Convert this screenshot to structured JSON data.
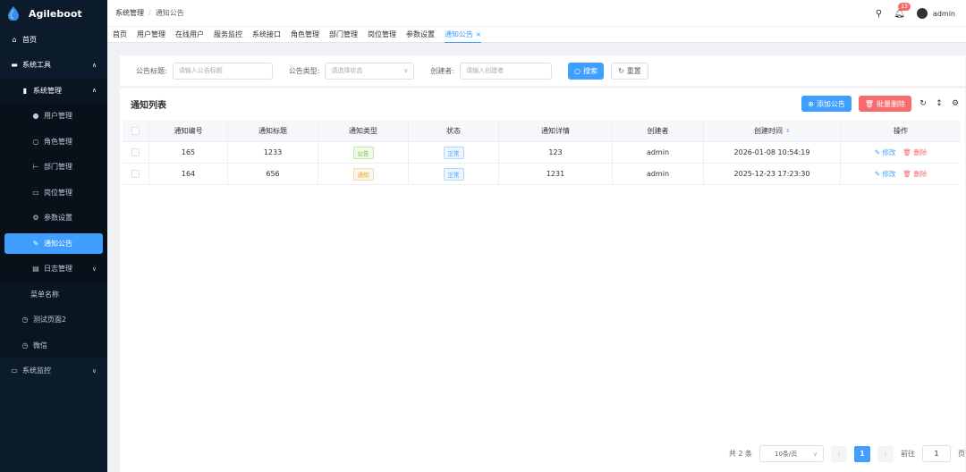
{
  "app": {
    "title": "Agileboot"
  },
  "sidebar": {
    "items": [
      {
        "label": "首页",
        "icon": "home-icon"
      },
      {
        "label": "系统工具",
        "icon": "briefcase-icon"
      },
      {
        "label": "系统管理",
        "icon": "chart-icon"
      },
      {
        "label": "用户管理",
        "icon": "user-icon"
      },
      {
        "label": "角色管理",
        "icon": "user-outline-icon"
      },
      {
        "label": "部门管理",
        "icon": "tree-icon"
      },
      {
        "label": "岗位管理",
        "icon": "post-icon"
      },
      {
        "label": "参数设置",
        "icon": "gear-icon"
      },
      {
        "label": "通知公告",
        "icon": "edit-icon"
      },
      {
        "label": "日志管理",
        "icon": "document-icon"
      },
      {
        "label": "菜单名称",
        "icon": ""
      },
      {
        "label": "测试页面2",
        "icon": "alarm-icon"
      },
      {
        "label": "微信",
        "icon": "alarm-icon"
      },
      {
        "label": "系统监控",
        "icon": "monitor-icon"
      }
    ]
  },
  "header": {
    "breadcrumb": [
      "系统管理",
      "通知公告"
    ],
    "notification_count": "13",
    "username": "admin"
  },
  "tabs": [
    {
      "label": "首页"
    },
    {
      "label": "用户管理"
    },
    {
      "label": "在线用户"
    },
    {
      "label": "服务监控"
    },
    {
      "label": "系统接口"
    },
    {
      "label": "角色管理"
    },
    {
      "label": "部门管理"
    },
    {
      "label": "岗位管理"
    },
    {
      "label": "参数设置"
    },
    {
      "label": "通知公告 ×"
    }
  ],
  "search": {
    "title_label": "公告标题:",
    "title_placeholder": "请输入公告标题",
    "type_label": "公告类型:",
    "type_placeholder": "请选择状态",
    "creator_label": "创建者:",
    "creator_placeholder": "请输入创建者",
    "search_btn": "搜索",
    "reset_btn": "重置"
  },
  "table": {
    "title": "通知列表",
    "add_btn": "添加公告",
    "batch_delete_btn": "批量删除",
    "columns": [
      "通知编号",
      "通知标题",
      "通知类型",
      "状态",
      "通知详情",
      "创建者",
      "创建时间",
      "操作"
    ],
    "rows": [
      {
        "id": "165",
        "title": "1233",
        "type": "公告",
        "status": "正常",
        "detail": "123",
        "creator": "admin",
        "time": "2026-01-08 10:54:19",
        "edit": "修改",
        "delete": "删除"
      },
      {
        "id": "164",
        "title": "656",
        "type": "通知",
        "status": "正常",
        "detail": "1231",
        "creator": "admin",
        "time": "2025-12-23 17:23:30",
        "edit": "修改",
        "delete": "删除"
      }
    ]
  },
  "pagination": {
    "total": "共 2 条",
    "page_size": "10条/页",
    "current": "1",
    "goto_label": "前往",
    "goto_value": "1",
    "page_suffix": "页"
  },
  "colors": {
    "primary": "#409eff",
    "danger": "#f56c6c",
    "sidebar": "#0c1b2c"
  }
}
